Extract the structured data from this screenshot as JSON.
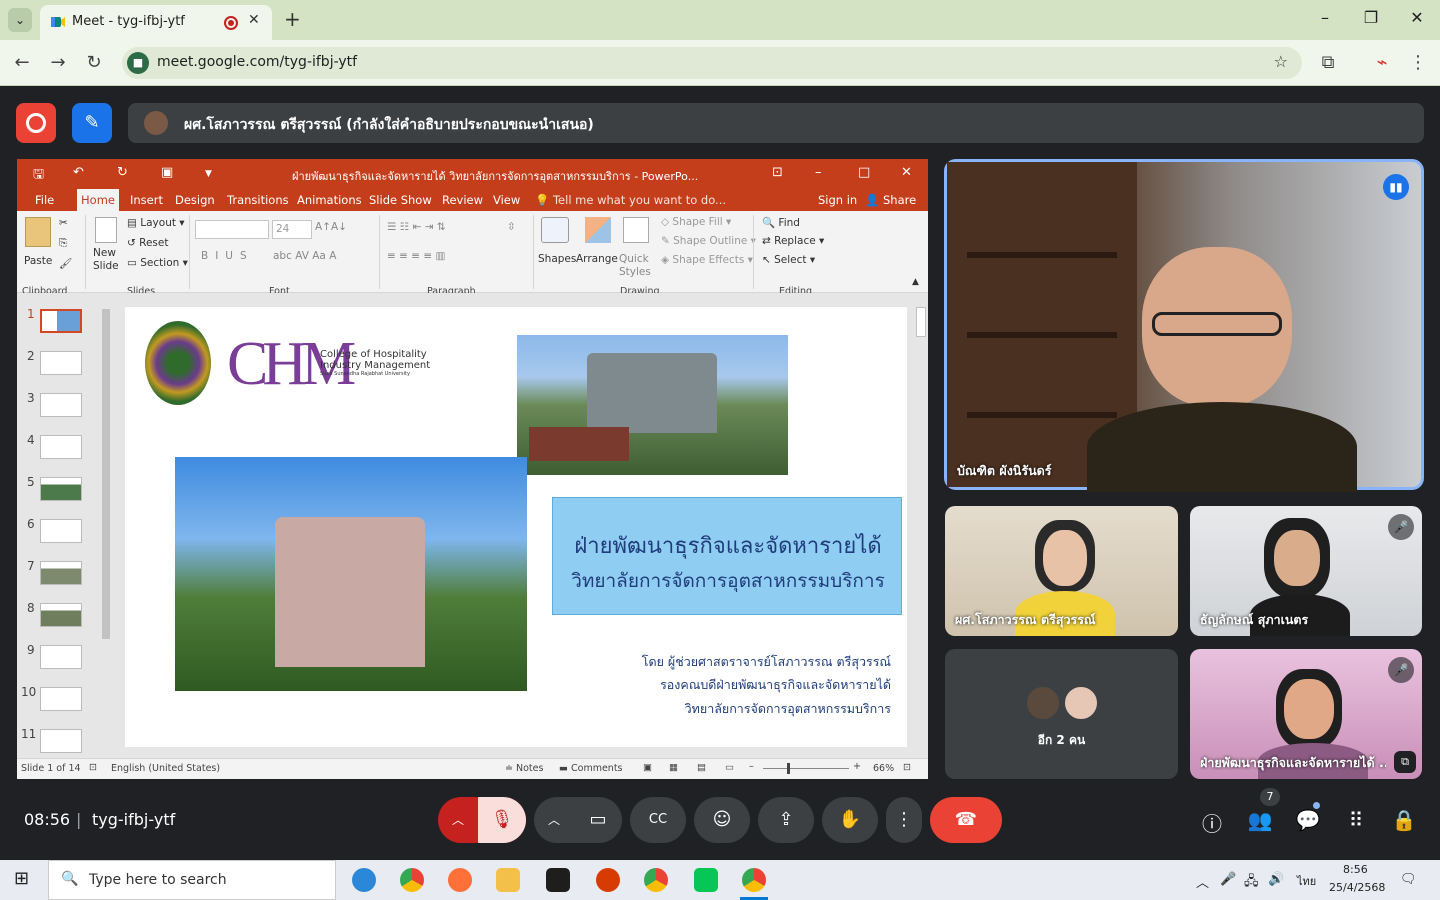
{
  "browser": {
    "tab_title": "Meet - tyg-ifbj-ytf",
    "url": "meet.google.com/tyg-ifbj-ytf",
    "new_tab": "+",
    "win_min": "–",
    "win_max": "❐",
    "win_close": "✕"
  },
  "meet": {
    "presenter_banner": "ผศ.โสภาวรรณ ตรีสุวรรณ์ (กำลังใส่คำอธิบายประกอบขณะนำเสนอ)",
    "time": "08:56",
    "meeting_code": "tyg-ifbj-ytf",
    "participant_count": "7",
    "participants": [
      {
        "name": "บัณฑิต ผังนิรันดร์",
        "speaking": true
      },
      {
        "name": "ผศ.โสภาวรรณ ตรีสุวรรณ์",
        "muted": false
      },
      {
        "name": "ธัญลักษณ์ สุภาเนตร",
        "muted": true
      },
      {
        "name": "อีก 2 คน",
        "muted": false
      },
      {
        "name": "ฝ่ายพัฒนาธุรกิจและจัดหารายได้ ...",
        "muted": true
      }
    ]
  },
  "ppt": {
    "title": "ฝ่ายพัฒนาธุรกิจและจัดหารายได้ วิทยาลัยการจัดการอุตสาหกรรมบริการ - PowerPo...",
    "menu": [
      "File",
      "Home",
      "Insert",
      "Design",
      "Transitions",
      "Animations",
      "Slide Show",
      "Review",
      "View"
    ],
    "tell_me": "Tell me what you want to do...",
    "sign_in": "Sign in",
    "share": "Share",
    "ribbon": {
      "paste": "Paste",
      "new_slide": "New Slide",
      "layout": "Layout",
      "reset": "Reset",
      "section": "Section",
      "font_size": "24",
      "shapes": "Shapes",
      "arrange": "Arrange",
      "quick_styles": "Quick Styles",
      "shape_fill": "Shape Fill",
      "shape_outline": "Shape Outline",
      "shape_effects": "Shape Effects",
      "find": "Find",
      "replace": "Replace",
      "select": "Select",
      "groups": [
        "Clipboard",
        "Slides",
        "Font",
        "Paragraph",
        "Drawing",
        "Editing"
      ]
    },
    "thumb_numbers": [
      "1",
      "2",
      "3",
      "4",
      "5",
      "6",
      "7",
      "8",
      "9",
      "10",
      "11"
    ],
    "status": {
      "slide_of": "Slide 1 of 14",
      "language": "English (United States)",
      "notes": "Notes",
      "comments": "Comments",
      "zoom": "66%"
    },
    "slide": {
      "logo_letters": "CHM",
      "logo_line1": "College of Hospitality",
      "logo_line2": "Industry Management",
      "logo_line3": "Suan Sunandha Rajabhat University",
      "title_line1": "ฝ่ายพัฒนาธุรกิจและจัดหารายได้",
      "title_line2": "วิทยาลัยการจัดการอุตสาหกรรมบริการ",
      "by_line1": "โดย ผู้ช่วยศาสตราจารย์โสภาวรรณ  ตรีสุวรรณ์",
      "by_line2": "รองคณบดีฝ่ายพัฒนาธุรกิจและจัดหารายได้",
      "by_line3": "วิทยาลัยการจัดการอุตสาหกรรมบริการ"
    }
  },
  "taskbar": {
    "search_placeholder": "Type here to search",
    "lang": "ไทย",
    "time": "8:56",
    "date": "25/4/2568"
  }
}
